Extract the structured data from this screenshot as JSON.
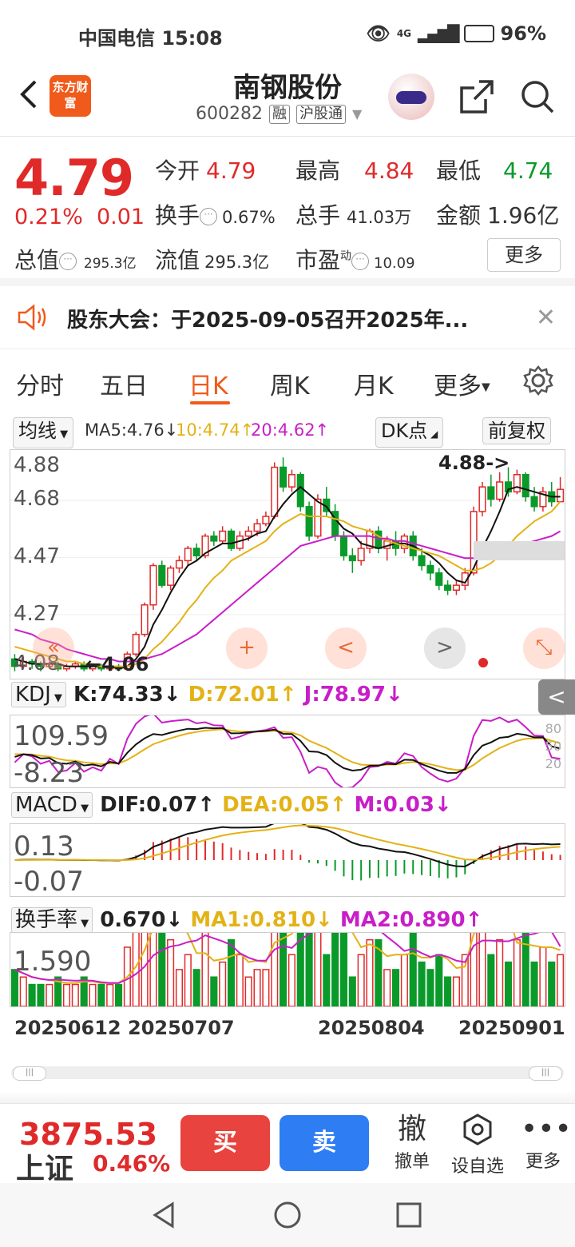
{
  "status_bar": {
    "carrier": "中国电信",
    "time": "15:08",
    "network": "4G",
    "battery": "96%"
  },
  "header": {
    "logo_text": "东方财富",
    "title": "南钢股份",
    "code": "600282",
    "tag_margin": "融",
    "tag_market": "沪股通"
  },
  "quote": {
    "price": "4.79",
    "change_pct": "0.21%",
    "change": "0.01",
    "open_label": "今开",
    "open": "4.79",
    "high_label": "最高",
    "high": "4.84",
    "low_label": "最低",
    "low": "4.74",
    "turnover_label": "换手",
    "turnover": "0.67%",
    "volume_label": "总手",
    "volume": "41.03万",
    "amount_label": "金额",
    "amount": "1.96亿",
    "mcap_label": "总值",
    "mcap": "295.3亿",
    "float_label": "流值",
    "float_mcap": "295.3亿",
    "pe_label": "市盈",
    "pe_sup": "动",
    "pe": "10.09",
    "more_button": "更多"
  },
  "notice": {
    "text": "股东大会：于2025-09-05召开2025年..."
  },
  "tabs": [
    "分时",
    "五日",
    "日K",
    "周K",
    "月K",
    "更多"
  ],
  "active_tab": "日K",
  "chart_toolbar": {
    "ma_select": "均线",
    "ma5": "MA5:4.76↓",
    "ma10": "10:4.74↑",
    "ma20": "20:4.62↑",
    "dk_button": "DK点",
    "adjust_button": "前复权"
  },
  "chart_data": {
    "type": "candlestick",
    "y_ticks": [
      "4.88",
      "4.68",
      "4.47",
      "4.27",
      "4.08"
    ],
    "ylim": [
      4.02,
      4.95
    ],
    "annotation_high": "4.88->",
    "annotation_low": "4.06",
    "candles": [
      [
        4.1,
        4.07,
        4.12,
        4.05
      ],
      [
        4.07,
        4.09,
        4.11,
        4.06
      ],
      [
        4.09,
        4.08,
        4.1,
        4.06
      ],
      [
        4.08,
        4.07,
        4.09,
        4.05
      ],
      [
        4.07,
        4.08,
        4.09,
        4.06
      ],
      [
        4.08,
        4.06,
        4.09,
        4.05
      ],
      [
        4.06,
        4.07,
        4.08,
        4.05
      ],
      [
        4.07,
        4.08,
        4.09,
        4.06
      ],
      [
        4.08,
        4.06,
        4.09,
        4.05
      ],
      [
        4.06,
        4.07,
        4.08,
        4.05
      ],
      [
        4.07,
        4.06,
        4.08,
        4.05
      ],
      [
        4.06,
        4.07,
        4.08,
        4.05
      ],
      [
        4.07,
        4.06,
        4.08,
        4.05
      ],
      [
        4.06,
        4.12,
        4.13,
        4.06
      ],
      [
        4.12,
        4.2,
        4.21,
        4.11
      ],
      [
        4.2,
        4.32,
        4.33,
        4.19
      ],
      [
        4.32,
        4.48,
        4.49,
        4.3
      ],
      [
        4.48,
        4.4,
        4.5,
        4.39
      ],
      [
        4.4,
        4.47,
        4.48,
        4.38
      ],
      [
        4.47,
        4.5,
        4.52,
        4.45
      ],
      [
        4.5,
        4.55,
        4.56,
        4.48
      ],
      [
        4.55,
        4.52,
        4.57,
        4.5
      ],
      [
        4.52,
        4.6,
        4.61,
        4.51
      ],
      [
        4.6,
        4.58,
        4.62,
        4.56
      ],
      [
        4.58,
        4.62,
        4.64,
        4.57
      ],
      [
        4.62,
        4.55,
        4.63,
        4.54
      ],
      [
        4.55,
        4.6,
        4.62,
        4.54
      ],
      [
        4.6,
        4.62,
        4.64,
        4.58
      ],
      [
        4.62,
        4.65,
        4.67,
        4.6
      ],
      [
        4.65,
        4.68,
        4.7,
        4.64
      ],
      [
        4.68,
        4.88,
        4.9,
        4.67
      ],
      [
        4.88,
        4.8,
        4.92,
        4.78
      ],
      [
        4.8,
        4.85,
        4.87,
        4.78
      ],
      [
        4.85,
        4.72,
        4.86,
        4.7
      ],
      [
        4.72,
        4.6,
        4.74,
        4.58
      ],
      [
        4.6,
        4.75,
        4.77,
        4.59
      ],
      [
        4.75,
        4.7,
        4.8,
        4.68
      ],
      [
        4.7,
        4.6,
        4.73,
        4.58
      ],
      [
        4.6,
        4.52,
        4.62,
        4.5
      ],
      [
        4.52,
        4.5,
        4.55,
        4.45
      ],
      [
        4.5,
        4.55,
        4.58,
        4.48
      ],
      [
        4.55,
        4.62,
        4.63,
        4.53
      ],
      [
        4.62,
        4.55,
        4.64,
        4.53
      ],
      [
        4.55,
        4.58,
        4.6,
        4.5
      ],
      [
        4.58,
        4.55,
        4.62,
        4.52
      ],
      [
        4.55,
        4.6,
        4.61,
        4.53
      ],
      [
        4.6,
        4.52,
        4.62,
        4.5
      ],
      [
        4.52,
        4.48,
        4.55,
        4.46
      ],
      [
        4.48,
        4.45,
        4.5,
        4.42
      ],
      [
        4.45,
        4.4,
        4.47,
        4.38
      ],
      [
        4.4,
        4.38,
        4.42,
        4.36
      ],
      [
        4.38,
        4.4,
        4.42,
        4.36
      ],
      [
        4.4,
        4.45,
        4.47,
        4.38
      ],
      [
        4.45,
        4.7,
        4.72,
        4.44
      ],
      [
        4.7,
        4.8,
        4.82,
        4.68
      ],
      [
        4.8,
        4.75,
        4.85,
        4.72
      ],
      [
        4.75,
        4.82,
        4.86,
        4.74
      ],
      [
        4.82,
        4.78,
        4.88,
        4.76
      ],
      [
        4.78,
        4.85,
        4.87,
        4.77
      ],
      [
        4.85,
        4.76,
        4.86,
        4.74
      ],
      [
        4.76,
        4.72,
        4.8,
        4.7
      ],
      [
        4.72,
        4.78,
        4.8,
        4.7
      ],
      [
        4.78,
        4.74,
        4.82,
        4.72
      ],
      [
        4.74,
        4.79,
        4.84,
        4.74
      ]
    ],
    "ma5": [
      4.1,
      4.09,
      4.08,
      4.08,
      4.08,
      4.08,
      4.07,
      4.07,
      4.07,
      4.07,
      4.07,
      4.07,
      4.06,
      4.07,
      4.1,
      4.15,
      4.24,
      4.3,
      4.37,
      4.43,
      4.48,
      4.5,
      4.53,
      4.55,
      4.57,
      4.57,
      4.58,
      4.59,
      4.61,
      4.62,
      4.68,
      4.73,
      4.77,
      4.8,
      4.77,
      4.74,
      4.72,
      4.67,
      4.63,
      4.61,
      4.57,
      4.56,
      4.55,
      4.56,
      4.57,
      4.57,
      4.56,
      4.54,
      4.52,
      4.49,
      4.45,
      4.42,
      4.41,
      4.47,
      4.55,
      4.62,
      4.7,
      4.79,
      4.8,
      4.79,
      4.78,
      4.77,
      4.76,
      4.76
    ],
    "ma10": [
      4.15,
      4.14,
      4.13,
      4.12,
      4.11,
      4.1,
      4.09,
      4.09,
      4.08,
      4.08,
      4.07,
      4.07,
      4.07,
      4.07,
      4.08,
      4.1,
      4.14,
      4.17,
      4.21,
      4.25,
      4.3,
      4.34,
      4.39,
      4.43,
      4.46,
      4.5,
      4.52,
      4.54,
      4.56,
      4.58,
      4.62,
      4.65,
      4.67,
      4.69,
      4.68,
      4.68,
      4.68,
      4.67,
      4.66,
      4.64,
      4.63,
      4.62,
      4.6,
      4.58,
      4.57,
      4.56,
      4.55,
      4.54,
      4.53,
      4.52,
      4.5,
      4.48,
      4.46,
      4.46,
      4.47,
      4.49,
      4.52,
      4.56,
      4.6,
      4.63,
      4.66,
      4.68,
      4.7,
      4.74
    ],
    "ma20": [
      4.22,
      4.21,
      4.2,
      4.18,
      4.17,
      4.16,
      4.14,
      4.13,
      4.12,
      4.11,
      4.1,
      4.1,
      4.09,
      4.09,
      4.09,
      4.1,
      4.11,
      4.12,
      4.14,
      4.16,
      4.18,
      4.2,
      4.23,
      4.26,
      4.29,
      4.32,
      4.35,
      4.38,
      4.41,
      4.44,
      4.47,
      4.5,
      4.53,
      4.56,
      4.57,
      4.58,
      4.59,
      4.6,
      4.6,
      4.6,
      4.6,
      4.6,
      4.59,
      4.59,
      4.58,
      4.58,
      4.57,
      4.56,
      4.55,
      4.54,
      4.53,
      4.52,
      4.51,
      4.51,
      4.52,
      4.53,
      4.54,
      4.55,
      4.56,
      4.57,
      4.58,
      4.59,
      4.6,
      4.62
    ]
  },
  "float_controls": {
    "prev": "<",
    "next": ">",
    "plus": "+"
  },
  "kdj": {
    "select": "KDJ",
    "k": "K:74.33↓",
    "d": "D:72.01↑",
    "j": "J:78.97↓",
    "top": "109.59",
    "bottom": "-8.23",
    "levels": [
      "80",
      "50",
      "20"
    ]
  },
  "macd": {
    "select": "MACD",
    "dif": "DIF:0.07↑",
    "dea": "DEA:0.05↑",
    "m": "M:0.03↓",
    "top": "0.13",
    "bottom": "-0.07"
  },
  "turnover": {
    "select": "换手率",
    "val": "0.670↓",
    "ma1": "MA1:0.810↓",
    "ma2": "MA2:0.890↑",
    "top": "1.590"
  },
  "dates": [
    "20250612",
    "20250707",
    "20250804",
    "20250901"
  ],
  "bottom_bar": {
    "index_value": "3875.53",
    "index_name": "上证",
    "index_pct": "0.46%",
    "buy": "买",
    "sell": "卖",
    "cancel_icon": "撤",
    "cancel": "撤单",
    "watch": "设自选",
    "more": "更多"
  }
}
